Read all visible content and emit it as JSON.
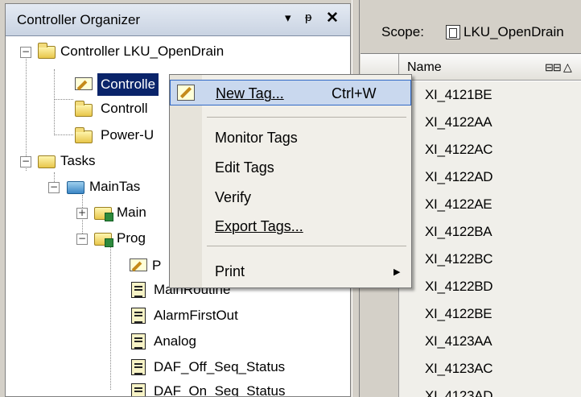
{
  "organizer": {
    "title": "Controller Organizer",
    "pin_dropdown": "▾",
    "pin": "ꟺ",
    "close": "✕"
  },
  "tree": {
    "controller": "Controller LKU_OpenDrain",
    "controller_tags": "Controlle",
    "controller_fault": "Controll",
    "powerup": "Power-U",
    "tasks": "Tasks",
    "maintask": "MainTas",
    "mainprog": "Main",
    "progtags": "Prog",
    "p_item": "P",
    "mainroutine": "MainRoutine",
    "routines": [
      "AlarmFirstOut",
      "Analog",
      "DAF_Off_Seq_Status",
      "DAF_On_Seq_Status"
    ]
  },
  "scope": {
    "label": "Scope:",
    "value": "LKU_OpenDrain"
  },
  "grid": {
    "col_name": "Name",
    "rows": [
      "XI_4121BE",
      "XI_4122AA",
      "XI_4122AC",
      "XI_4122AD",
      "XI_4122AE",
      "XI_4122BA",
      "XI_4122BC",
      "XI_4122BD",
      "XI_4122BE",
      "XI_4123AA",
      "XI_4123AC",
      "XI_4123AD"
    ]
  },
  "context_menu": {
    "new_tag": "New Tag...",
    "new_tag_shortcut": "Ctrl+W",
    "monitor_tags": "Monitor Tags",
    "edit_tags": "Edit Tags",
    "verify": "Verify",
    "export_tags": "Export Tags...",
    "print": "Print"
  }
}
